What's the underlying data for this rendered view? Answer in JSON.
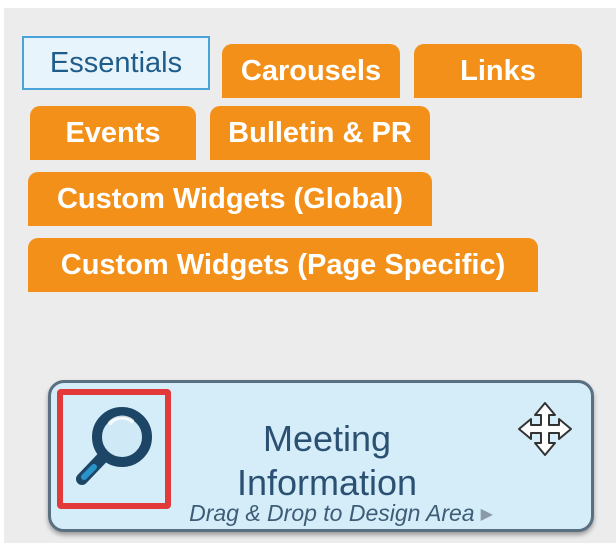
{
  "tabs": [
    {
      "label": "Essentials",
      "active": true
    },
    {
      "label": "Carousels",
      "active": false
    },
    {
      "label": "Links",
      "active": false
    },
    {
      "label": "Events",
      "active": false
    },
    {
      "label": "Bulletin & PR",
      "active": false
    },
    {
      "label": "Custom Widgets (Global)",
      "active": false
    },
    {
      "label": "Custom Widgets (Page Specific)",
      "active": false
    }
  ],
  "widget": {
    "title_line1": "Meeting",
    "title_line2": "Information",
    "hint": "Drag & Drop to Design Area",
    "icon": "magnifier-icon",
    "move_icon": "move-arrows-icon"
  },
  "colors": {
    "tab_orange": "#f39019",
    "active_tab_border": "#4aa3d8",
    "widget_bg": "#d5ecf9",
    "highlight_red": "#e23a3a",
    "magnifier_dark": "#1d4666",
    "magnifier_light": "#2a93c9"
  }
}
